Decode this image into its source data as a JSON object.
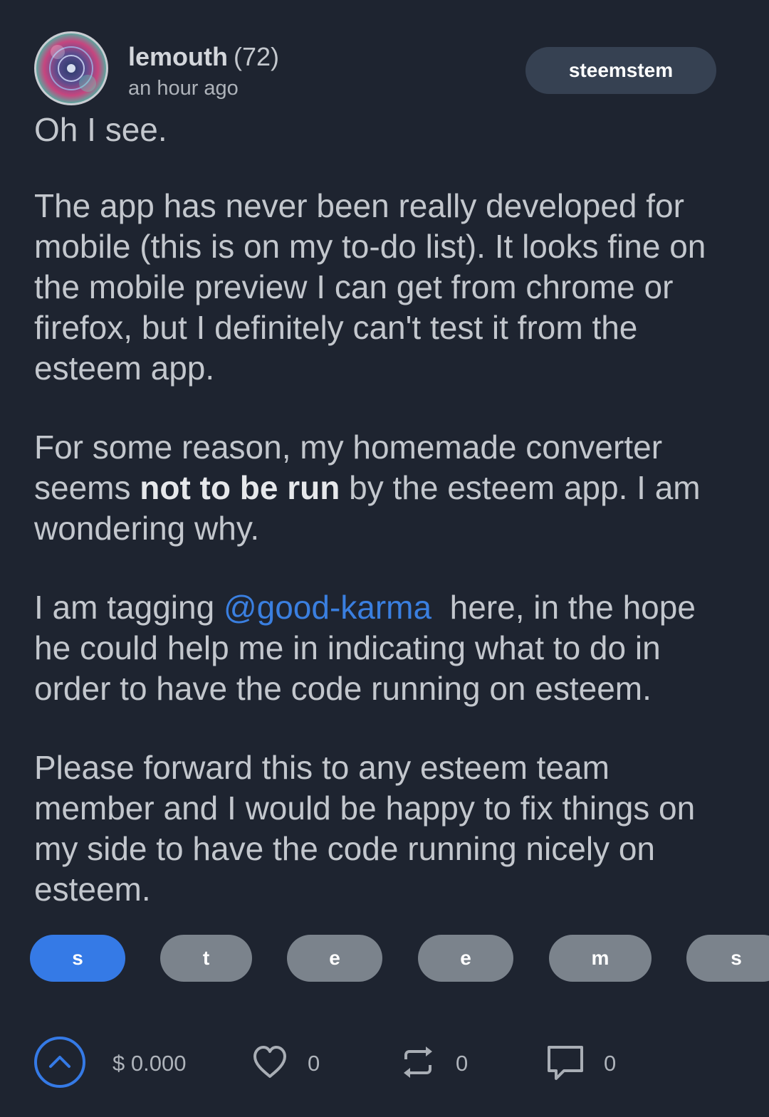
{
  "comment": {
    "author": "lemouth",
    "reputation": "(72)",
    "timestamp": "an hour ago",
    "community": "steemstem"
  },
  "body": {
    "p1": "Oh I see.",
    "p2": "The app has never been really developed for mobile (this is on my to-do list). It looks fine on the mobile preview I can get from chrome or firefox, but I definitely can't test it from the esteem app.",
    "p3_before": "For some reason, my homemade converter seems ",
    "p3_bold": "not to be run",
    "p3_after": " by the esteem app. I am wondering why.",
    "p4_before": "I am tagging ",
    "p4_mention": "@good-karma",
    "p4_after": "  here, in the hope he could help me in indicating what to do in order to have the code running on esteem.",
    "p5": "Please forward this to any esteem team member and I would be happy to fix things on my side to have the code running nicely on esteem."
  },
  "tags": [
    "s",
    "t",
    "e",
    "e",
    "m",
    "s"
  ],
  "footer": {
    "payout": "$ 0.000",
    "likes": "0",
    "reblogs": "0",
    "comments": "0"
  },
  "icons": {
    "upvote": "chevron-up-icon",
    "like": "heart-icon",
    "reblog": "repeat-icon",
    "comment": "comment-icon"
  },
  "colors": {
    "background": "#1e2430",
    "accent": "#357ae6",
    "mention": "#3a7fe0",
    "tag_inactive": "#7b838c",
    "community_pill": "#364152"
  }
}
